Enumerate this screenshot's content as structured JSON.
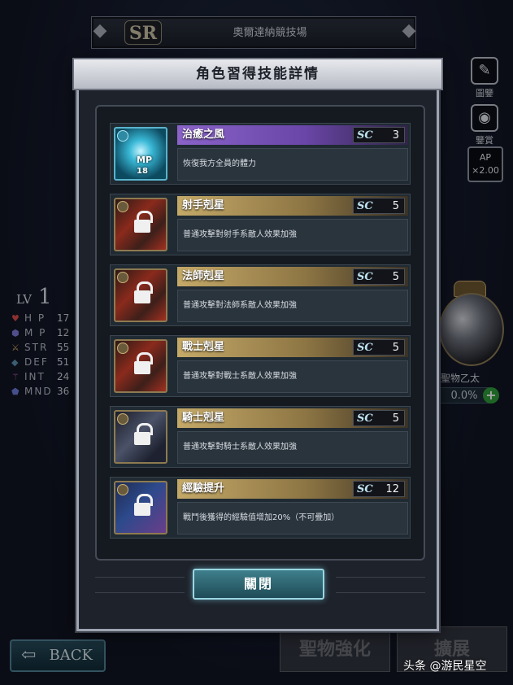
{
  "top_banner": {
    "rarity": "SR",
    "area_title": "奧爾達納競技場"
  },
  "side_menu": [
    {
      "label": "圖鑒",
      "icon": "book-icon"
    },
    {
      "label": "鑒賞",
      "icon": "eye-icon"
    }
  ],
  "ap": {
    "label": "AP",
    "multiplier": "×2.00"
  },
  "level": {
    "label": "LV",
    "value": "1"
  },
  "stats": [
    {
      "icon": "heart-icon",
      "name": "H P",
      "value": "17"
    },
    {
      "icon": "magic-icon",
      "name": "M P",
      "value": "12"
    },
    {
      "icon": "sword-icon",
      "name": "STR",
      "value": "55"
    },
    {
      "icon": "shield-icon",
      "name": "DEF",
      "value": "51"
    },
    {
      "icon": "staff-icon",
      "name": "INT",
      "value": "24"
    },
    {
      "icon": "mind-icon",
      "name": "MND",
      "value": "36"
    }
  ],
  "orb": {
    "label": "聖物乙太",
    "percent": "0.0%"
  },
  "bottom": {
    "back_label": "BACK",
    "btn_left": "聖物強化",
    "btn_right": "擴展"
  },
  "watermark": "头条 @游民星空",
  "modal": {
    "title": "角色習得技能詳情",
    "close_label": "關閉",
    "skills": [
      {
        "name": "治癒之風",
        "sc_label": "SC",
        "sc": "3",
        "desc": "恢復我方全員的體力",
        "locked": false,
        "mp_label": "MP",
        "mp": "18"
      },
      {
        "name": "射手剋星",
        "sc_label": "SC",
        "sc": "5",
        "desc": "普通攻擊對射手系敵人效果加強",
        "locked": true
      },
      {
        "name": "法師剋星",
        "sc_label": "SC",
        "sc": "5",
        "desc": "普通攻擊對法師系敵人效果加強",
        "locked": true
      },
      {
        "name": "戰士剋星",
        "sc_label": "SC",
        "sc": "5",
        "desc": "普通攻擊對戰士系敵人效果加強",
        "locked": true
      },
      {
        "name": "騎士剋星",
        "sc_label": "SC",
        "sc": "5",
        "desc": "普通攻擊對騎士系敵人效果加強",
        "locked": true
      },
      {
        "name": "經驗提升",
        "sc_label": "SC",
        "sc": "12",
        "desc": "戰鬥後獲得的經驗值增加20%（不可疊加）",
        "locked": true
      }
    ]
  },
  "colors": {
    "active_skill": "#8a63c9",
    "locked_skill": "#c4a968",
    "close_glow": "#9ad6e2"
  }
}
